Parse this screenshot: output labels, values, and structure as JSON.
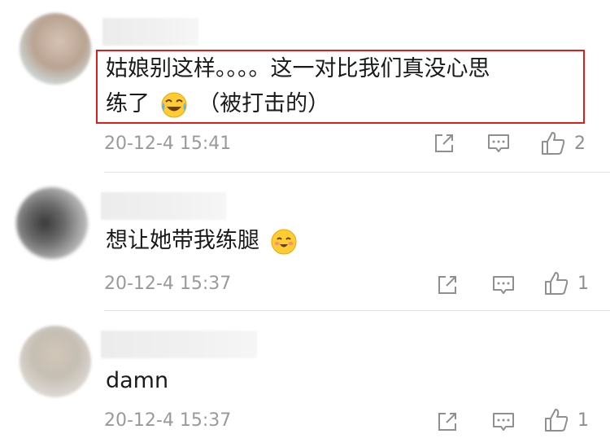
{
  "comments": [
    {
      "text_line1": "姑娘别这样。。。。这一对比我们真没心思",
      "text_line2_before": "练了",
      "emoji": "laughing-crying-emoji",
      "text_line2_after": "（被打击的）",
      "timestamp": "20-12-4 15:41",
      "likes": "2",
      "highlighted": true
    },
    {
      "text": "想让她带我练腿",
      "emoji": "blushing-smile-emoji",
      "timestamp": "20-12-4 15:37",
      "likes": "1"
    },
    {
      "text": "damn",
      "timestamp": "20-12-4 15:37",
      "likes": "1"
    }
  ],
  "colors": {
    "highlight_border": "#e01d1d",
    "meta_text": "#9a9a9a",
    "divider": "#e3e3e3"
  },
  "icons": [
    "share-icon",
    "reply-icon",
    "like-icon"
  ]
}
